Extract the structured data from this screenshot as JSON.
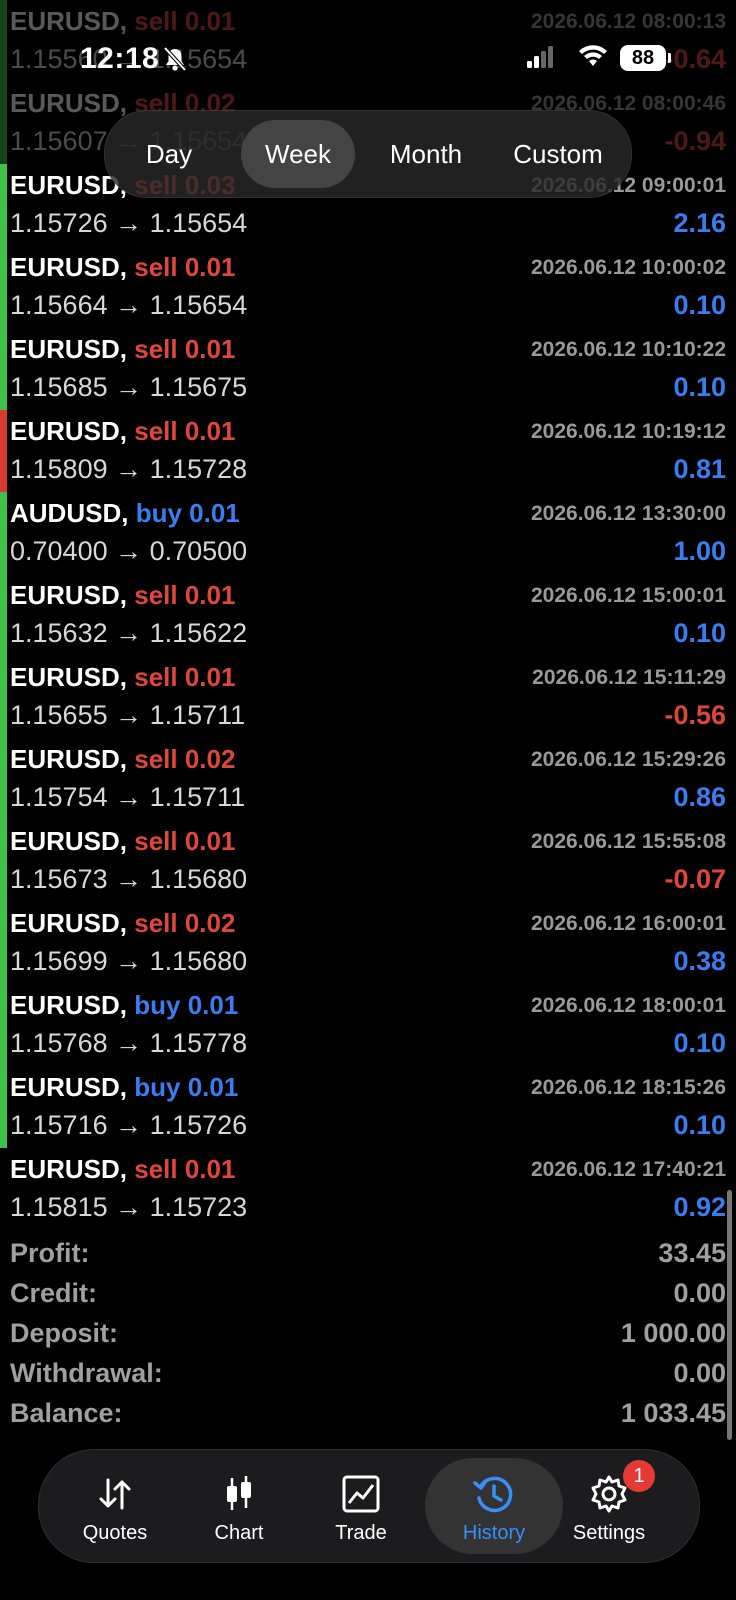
{
  "status_bar": {
    "time": "12:18",
    "battery": "88"
  },
  "periods": {
    "tabs": [
      "Day",
      "Week",
      "Month",
      "Custom"
    ],
    "selected": "Week"
  },
  "deals": [
    {
      "symbol": "EURUSD,",
      "side": "sell 0.01",
      "dir": "sell",
      "time": "2026.06.12 08:00:13",
      "prices": "1.15560 → 1.15654",
      "pl": "-0.64",
      "plsign": "neg",
      "bar": "green",
      "dimmed": true
    },
    {
      "symbol": "EURUSD,",
      "side": "sell 0.02",
      "dir": "sell",
      "time": "2026.06.12 08:00:46",
      "prices": "1.15607 → 1.15654",
      "pl": "-0.94",
      "plsign": "neg",
      "bar": "green",
      "dimmed": true
    },
    {
      "symbol": "EURUSD,",
      "side": "sell 0.03",
      "dir": "sell",
      "time": "2026.06.12 09:00:01",
      "prices": "1.15726 → 1.15654",
      "pl": "2.16",
      "plsign": "pos",
      "bar": "green",
      "dimmed": false
    },
    {
      "symbol": "EURUSD,",
      "side": "sell 0.01",
      "dir": "sell",
      "time": "2026.06.12 10:00:02",
      "prices": "1.15664 → 1.15654",
      "pl": "0.10",
      "plsign": "pos",
      "bar": "green",
      "dimmed": false
    },
    {
      "symbol": "EURUSD,",
      "side": "sell 0.01",
      "dir": "sell",
      "time": "2026.06.12 10:10:22",
      "prices": "1.15685 → 1.15675",
      "pl": "0.10",
      "plsign": "pos",
      "bar": "green",
      "dimmed": false
    },
    {
      "symbol": "EURUSD,",
      "side": "sell 0.01",
      "dir": "sell",
      "time": "2026.06.12 10:19:12",
      "prices": "1.15809 → 1.15728",
      "pl": "0.81",
      "plsign": "pos",
      "bar": "red",
      "dimmed": false
    },
    {
      "symbol": "AUDUSD,",
      "side": "buy 0.01",
      "dir": "buy",
      "time": "2026.06.12 13:30:00",
      "prices": "0.70400 → 0.70500",
      "pl": "1.00",
      "plsign": "pos",
      "bar": "green",
      "dimmed": false
    },
    {
      "symbol": "EURUSD,",
      "side": "sell 0.01",
      "dir": "sell",
      "time": "2026.06.12 15:00:01",
      "prices": "1.15632 → 1.15622",
      "pl": "0.10",
      "plsign": "pos",
      "bar": "green",
      "dimmed": false
    },
    {
      "symbol": "EURUSD,",
      "side": "sell 0.01",
      "dir": "sell",
      "time": "2026.06.12 15:11:29",
      "prices": "1.15655 → 1.15711",
      "pl": "-0.56",
      "plsign": "neg",
      "bar": "green",
      "dimmed": false
    },
    {
      "symbol": "EURUSD,",
      "side": "sell 0.02",
      "dir": "sell",
      "time": "2026.06.12 15:29:26",
      "prices": "1.15754 → 1.15711",
      "pl": "0.86",
      "plsign": "pos",
      "bar": "green",
      "dimmed": false
    },
    {
      "symbol": "EURUSD,",
      "side": "sell 0.01",
      "dir": "sell",
      "time": "2026.06.12 15:55:08",
      "prices": "1.15673 → 1.15680",
      "pl": "-0.07",
      "plsign": "neg",
      "bar": "green",
      "dimmed": false
    },
    {
      "symbol": "EURUSD,",
      "side": "sell 0.02",
      "dir": "sell",
      "time": "2026.06.12 16:00:01",
      "prices": "1.15699 → 1.15680",
      "pl": "0.38",
      "plsign": "pos",
      "bar": "green",
      "dimmed": false
    },
    {
      "symbol": "EURUSD,",
      "side": "buy 0.01",
      "dir": "buy",
      "time": "2026.06.12 18:00:01",
      "prices": "1.15768 → 1.15778",
      "pl": "0.10",
      "plsign": "pos",
      "bar": "green",
      "dimmed": false
    },
    {
      "symbol": "EURUSD,",
      "side": "buy 0.01",
      "dir": "buy",
      "time": "2026.06.12 18:15:26",
      "prices": "1.15716 → 1.15726",
      "pl": "0.10",
      "plsign": "pos",
      "bar": "green",
      "dimmed": false
    },
    {
      "symbol": "EURUSD,",
      "side": "sell 0.01",
      "dir": "sell",
      "time": "2026.06.12 17:40:21",
      "prices": "1.15815 → 1.15723",
      "pl": "0.92",
      "plsign": "pos",
      "bar": "none",
      "dimmed": false
    }
  ],
  "summary": [
    {
      "label": "Profit:",
      "value": "33.45"
    },
    {
      "label": "Credit:",
      "value": "0.00"
    },
    {
      "label": "Deposit:",
      "value": "1 000.00"
    },
    {
      "label": "Withdrawal:",
      "value": "0.00"
    },
    {
      "label": "Balance:",
      "value": "1 033.45"
    }
  ],
  "tabbar": {
    "items": [
      {
        "label": "Quotes",
        "icon": "quotes-arrows-icon"
      },
      {
        "label": "Chart",
        "icon": "candlestick-chart-icon"
      },
      {
        "label": "Trade",
        "icon": "trade-chart-icon"
      },
      {
        "label": "History",
        "icon": "history-clock-icon"
      },
      {
        "label": "Settings",
        "icon": "gear-icon"
      }
    ],
    "active": "History",
    "settings_badge": "1"
  },
  "colors": {
    "sell": "#e0463a",
    "buy": "#3a7df0",
    "bar_green": "#3ec24a",
    "bar_red": "#d93a30",
    "accent": "#3a8ef6"
  }
}
